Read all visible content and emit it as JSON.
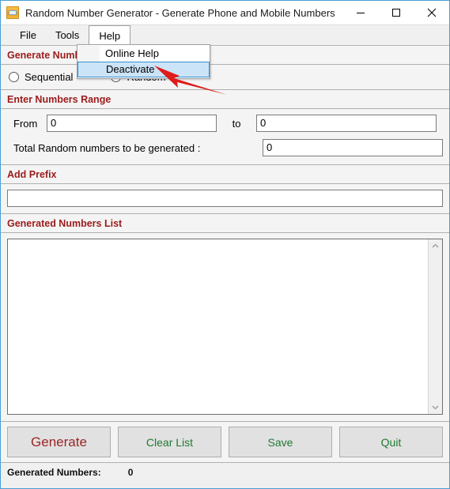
{
  "window": {
    "title": "Random Number Generator - Generate Phone and Mobile Numbers",
    "icon": "app-calculator-icon",
    "border_color": "#4a9ed4",
    "controls": {
      "minimize": "minimize-icon",
      "maximize": "maximize-icon",
      "close": "close-icon"
    }
  },
  "menubar": {
    "items": [
      {
        "label": "File",
        "open": false
      },
      {
        "label": "Tools",
        "open": false
      },
      {
        "label": "Help",
        "open": true
      }
    ]
  },
  "dropdown": {
    "owner": "Help",
    "items": [
      {
        "label": "Online Help",
        "highlighted": false
      },
      {
        "label": "Deactivate",
        "highlighted": true
      }
    ],
    "highlight_color": "#cce4f7",
    "highlight_border": "#3a8fd0"
  },
  "annotation": {
    "type": "arrow",
    "color": "#e01b1b",
    "points_to": "Deactivate"
  },
  "sections": {
    "generate_numbers": {
      "title": "Generate Numbers",
      "options": [
        {
          "label": "Sequential",
          "checked": false
        },
        {
          "label": "Random",
          "checked": true
        }
      ]
    },
    "numbers_range": {
      "title": "Enter Numbers Range",
      "from_label": "From",
      "from_value": "0",
      "to_label": "to",
      "to_value": "0",
      "total_label": "Total Random numbers to be generated :",
      "total_value": "0"
    },
    "add_prefix": {
      "title": "Add Prefix",
      "value": "",
      "placeholder": ""
    },
    "generated_list": {
      "title": "Generated Numbers List",
      "value": "",
      "scroll_up_icon": "chevron-up-icon",
      "scroll_down_icon": "chevron-down-icon"
    }
  },
  "buttons": {
    "generate": {
      "label": "Generate",
      "color": "#9b2526"
    },
    "clear": {
      "label": "Clear List",
      "color": "#1f7a32"
    },
    "save": {
      "label": "Save",
      "color": "#1f7a32"
    },
    "quit": {
      "label": "Quit",
      "color": "#1f7a32"
    }
  },
  "statusbar": {
    "label": "Generated Numbers:",
    "count": "0"
  },
  "theme": {
    "section_title_color": "#9b1b1b",
    "panel_bg": "#f4f4f4",
    "button_bg": "#e1e1e1"
  }
}
